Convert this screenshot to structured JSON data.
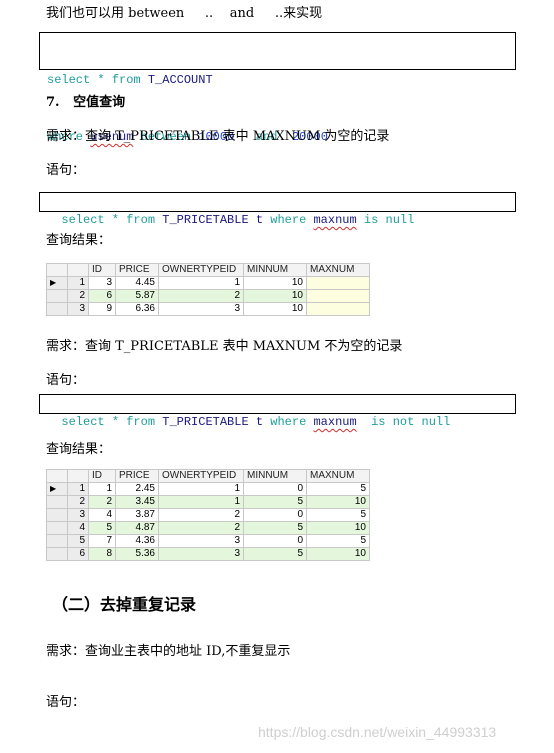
{
  "intro_text": "我们也可以用 between     ..    and     ..来实现",
  "code1": {
    "line1": {
      "kw1": "select",
      "star": " * ",
      "kw2": "from",
      "table": " T_ACCOUNT"
    },
    "line2": {
      "kw1": "where",
      "col": "usenum",
      "kw2": "between",
      "n1": "10000",
      "kw3": "and",
      "n2": "20000"
    }
  },
  "section7_title": "7.   空值查询",
  "req1": "需求：查询 T_PRICETABLE 表中 MAXNUM 为空的记录",
  "stmt_label1": "语句：",
  "code2": {
    "kw1": "select",
    "star": " * ",
    "kw2": "from",
    "table": " T_PRICETABLE t ",
    "kw3": "where",
    "col": "maxnum",
    "kw4": "is null"
  },
  "result_label1": "查询结果：",
  "table1": {
    "headers": [
      "ID",
      "PRICE",
      "OWNERTYPEID",
      "MINNUM",
      "MAXNUM"
    ],
    "rows": [
      {
        "rn": "1",
        "cells": [
          "3",
          "4.45",
          "1",
          "10",
          ""
        ]
      },
      {
        "rn": "2",
        "cells": [
          "6",
          "5.87",
          "2",
          "10",
          ""
        ]
      },
      {
        "rn": "3",
        "cells": [
          "9",
          "6.36",
          "3",
          "10",
          ""
        ]
      }
    ]
  },
  "req2": "需求：查询 T_PRICETABLE 表中 MAXNUM 不为空的记录",
  "stmt_label2": "语句：",
  "code3": {
    "kw1": "select",
    "star": " * ",
    "kw2": "from",
    "table": " T_PRICETABLE t ",
    "kw3": "where",
    "col": "maxnum",
    "kw4": "is not null"
  },
  "result_label2": "查询结果：",
  "table2": {
    "headers": [
      "ID",
      "PRICE",
      "OWNERTYPEID",
      "MINNUM",
      "MAXNUM"
    ],
    "rows": [
      {
        "rn": "1",
        "cells": [
          "1",
          "2.45",
          "1",
          "0",
          "5"
        ]
      },
      {
        "rn": "2",
        "cells": [
          "2",
          "3.45",
          "1",
          "5",
          "10"
        ]
      },
      {
        "rn": "3",
        "cells": [
          "4",
          "3.87",
          "2",
          "0",
          "5"
        ]
      },
      {
        "rn": "4",
        "cells": [
          "5",
          "4.87",
          "2",
          "5",
          "10"
        ]
      },
      {
        "rn": "5",
        "cells": [
          "7",
          "4.36",
          "3",
          "0",
          "5"
        ]
      },
      {
        "rn": "6",
        "cells": [
          "8",
          "5.36",
          "3",
          "5",
          "10"
        ]
      }
    ]
  },
  "section2_title": "（二）去掉重复记录",
  "req3": "需求：查询业主表中的地址 ID,不重复显示",
  "stmt_label3": "语句：",
  "watermark": "https://blog.csdn.net/weixin_44993313"
}
